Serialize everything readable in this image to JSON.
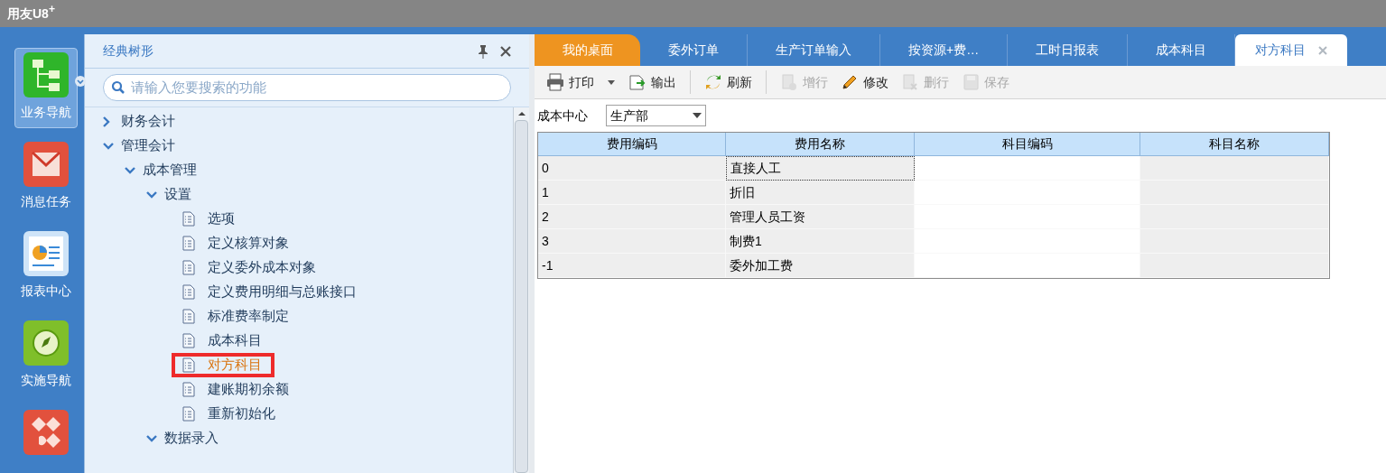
{
  "window": {
    "title": "用友U8",
    "title_sup": "+"
  },
  "nav": [
    {
      "kind": "tree",
      "label": "业务导航",
      "selected": true,
      "dropdown": true
    },
    {
      "kind": "mail",
      "label": "消息任务",
      "selected": false
    },
    {
      "kind": "report",
      "label": "报表中心",
      "selected": false
    },
    {
      "kind": "compass",
      "label": "实施导航",
      "selected": false
    },
    {
      "kind": "apps",
      "selected": false
    }
  ],
  "tree_panel": {
    "title": "经典树形",
    "search": {
      "placeholder": "请输入您要搜索的功能"
    },
    "items": [
      {
        "label": "财务会计",
        "expanded": false
      },
      {
        "label": "管理会计",
        "expanded": true,
        "children": [
          {
            "label": "成本管理",
            "expanded": true,
            "children": [
              {
                "label": "设置",
                "expanded": true,
                "children": [
                  {
                    "label": "选项",
                    "selected": false
                  },
                  {
                    "label": "定义核算对象",
                    "selected": false
                  },
                  {
                    "label": "定义委外成本对象",
                    "selected": false
                  },
                  {
                    "label": "定义费用明细与总账接口",
                    "selected": false
                  },
                  {
                    "label": "标准费率制定",
                    "selected": false
                  },
                  {
                    "label": "成本科目",
                    "selected": false
                  },
                  {
                    "label": "对方科目",
                    "selected": true
                  },
                  {
                    "label": "建账期初余额",
                    "selected": false
                  },
                  {
                    "label": "重新初始化",
                    "selected": false
                  }
                ]
              },
              {
                "label": "数据录入",
                "expanded": true
              }
            ]
          }
        ]
      }
    ]
  },
  "tabs": [
    {
      "label": "我的桌面",
      "kind": "home",
      "selected": false
    },
    {
      "label": "委外订单",
      "kind": "page",
      "selected": false
    },
    {
      "label": "生产订单输入",
      "kind": "page",
      "selected": false
    },
    {
      "label": "按资源+费…",
      "kind": "page",
      "selected": false
    },
    {
      "label": "工时日报表",
      "kind": "page",
      "selected": false
    },
    {
      "label": "成本科目",
      "kind": "page",
      "selected": false
    },
    {
      "label": "对方科目",
      "kind": "page",
      "selected": true
    }
  ],
  "toolbar": [
    {
      "kind": "print",
      "label": "打印",
      "disabled": false,
      "dropdown": true
    },
    {
      "kind": "export",
      "label": "输出",
      "disabled": false
    },
    {
      "kind": "refresh",
      "label": "刷新",
      "disabled": false,
      "separator_before": true
    },
    {
      "kind": "addrow",
      "label": "增行",
      "disabled": true,
      "separator_before": true
    },
    {
      "kind": "edit",
      "label": "修改",
      "disabled": false
    },
    {
      "kind": "delrow",
      "label": "删行",
      "disabled": true
    },
    {
      "kind": "save",
      "label": "保存",
      "disabled": true
    }
  ],
  "filter": {
    "label": "成本中心",
    "value": "生产部"
  },
  "table": {
    "columns": [
      "费用编码",
      "费用名称",
      "科目编码",
      "科目名称"
    ],
    "rows": [
      {
        "code": "0",
        "name": "直接人工",
        "name_focused": true
      },
      {
        "code": "1",
        "name": "折旧",
        "name_focused": false
      },
      {
        "code": "2",
        "name": "管理人员工资",
        "name_focused": false
      },
      {
        "code": "3",
        "name": "制费1",
        "name_focused": false
      },
      {
        "code": "-1",
        "name": "委外加工费",
        "name_focused": false
      }
    ]
  }
}
